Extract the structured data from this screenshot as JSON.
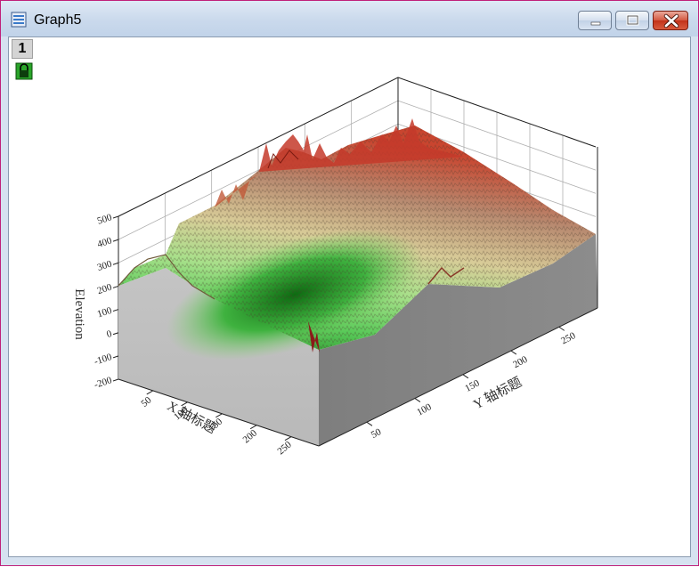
{
  "window": {
    "title": "Graph5",
    "layer_number": "1",
    "icons": [
      "graph-window-icon",
      "minimize-icon",
      "restore-icon",
      "close-icon",
      "lock-icon"
    ]
  },
  "chart_data": {
    "type": "3d-surface",
    "title": "",
    "xlabel": "X 轴标题",
    "ylabel": "Y 轴标题",
    "zlabel": "Elevation",
    "x_ticks": [
      "50",
      "100",
      "150",
      "200",
      "250"
    ],
    "y_ticks": [
      "50",
      "100",
      "150",
      "200",
      "250"
    ],
    "z_ticks": [
      "500",
      "400",
      "300",
      "200",
      "100",
      "0",
      "-100",
      "-200"
    ],
    "xlim": [
      0,
      290
    ],
    "ylim": [
      0,
      290
    ],
    "zlim": [
      -200,
      500
    ],
    "colormap": [
      "#1b7a1b",
      "#58c958",
      "#a7e08a",
      "#d8cc98",
      "#b88a70",
      "#c9452f"
    ],
    "side_wall_colors": [
      "#bdbdbd",
      "#8a8a8a"
    ],
    "grid": true
  }
}
